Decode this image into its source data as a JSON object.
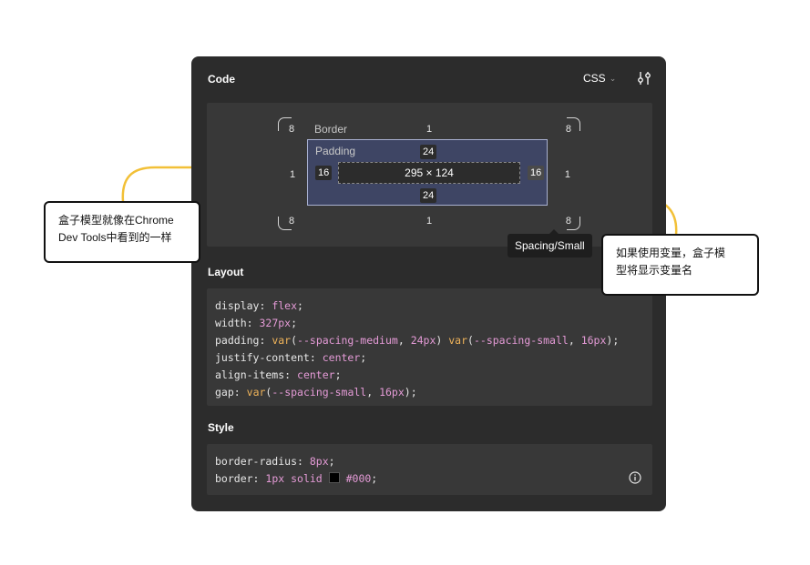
{
  "panel": {
    "title": "Code",
    "language": "CSS",
    "chevron": "⌄",
    "settings_icon": "sliders-icon"
  },
  "box_model": {
    "border_label": "Border",
    "border": {
      "top": "1",
      "bottom": "1",
      "left": "1",
      "right": "1"
    },
    "radius": {
      "tl": "8",
      "tr": "8",
      "bl": "8",
      "br": "8"
    },
    "padding_label": "Padding",
    "padding": {
      "top": "24",
      "bottom": "24",
      "left": "16",
      "right": "16"
    },
    "content_size": "295 × 124",
    "tooltip": "Spacing/Small"
  },
  "layout": {
    "title": "Layout",
    "lines": [
      [
        {
          "t": "display",
          "c": "p"
        },
        {
          "t": ": ",
          "c": "p"
        },
        {
          "t": "flex",
          "c": "v"
        },
        {
          "t": ";",
          "c": "p"
        }
      ],
      [
        {
          "t": "width",
          "c": "p"
        },
        {
          "t": ": ",
          "c": "p"
        },
        {
          "t": "327px",
          "c": "v"
        },
        {
          "t": ";",
          "c": "p"
        }
      ],
      [
        {
          "t": "padding",
          "c": "p"
        },
        {
          "t": ": ",
          "c": "p"
        },
        {
          "t": "var",
          "c": "o"
        },
        {
          "t": "(",
          "c": "p"
        },
        {
          "t": "--spacing-medium",
          "c": "v"
        },
        {
          "t": ", ",
          "c": "p"
        },
        {
          "t": "24px",
          "c": "v"
        },
        {
          "t": ") ",
          "c": "p"
        },
        {
          "t": "var",
          "c": "o"
        },
        {
          "t": "(",
          "c": "p"
        },
        {
          "t": "--spacing-small",
          "c": "v"
        },
        {
          "t": ", ",
          "c": "p"
        },
        {
          "t": "16px",
          "c": "v"
        },
        {
          "t": ");",
          "c": "p"
        }
      ],
      [
        {
          "t": "justify-content",
          "c": "p"
        },
        {
          "t": ": ",
          "c": "p"
        },
        {
          "t": "center",
          "c": "v"
        },
        {
          "t": ";",
          "c": "p"
        }
      ],
      [
        {
          "t": "align-items",
          "c": "p"
        },
        {
          "t": ": ",
          "c": "p"
        },
        {
          "t": "center",
          "c": "v"
        },
        {
          "t": ";",
          "c": "p"
        }
      ],
      [
        {
          "t": "gap",
          "c": "p"
        },
        {
          "t": ": ",
          "c": "p"
        },
        {
          "t": "var",
          "c": "o"
        },
        {
          "t": "(",
          "c": "p"
        },
        {
          "t": "--spacing-small",
          "c": "v"
        },
        {
          "t": ", ",
          "c": "p"
        },
        {
          "t": "16px",
          "c": "v"
        },
        {
          "t": ");",
          "c": "p"
        }
      ]
    ]
  },
  "style": {
    "title": "Style",
    "line1": [
      {
        "t": "border-radius",
        "c": "p"
      },
      {
        "t": ": ",
        "c": "p"
      },
      {
        "t": "8px",
        "c": "v"
      },
      {
        "t": ";",
        "c": "p"
      }
    ],
    "line2_prefix": [
      {
        "t": "border",
        "c": "p"
      },
      {
        "t": ": ",
        "c": "p"
      },
      {
        "t": "1px solid ",
        "c": "v"
      }
    ],
    "line2_color": "#000",
    "line2_suffix": ";",
    "swatch_color": "#000000",
    "info_icon": "info-icon"
  },
  "callouts": {
    "left_line1": "盒子模型就像在Chrome",
    "left_line2": "Dev Tools中看到的一样",
    "right_line1": "如果使用变量，盒子模",
    "right_line2": "型将显示变量名"
  },
  "colors": {
    "panel_bg": "#2c2c2c",
    "arrow": "#f2c037",
    "value_pink": "#e59bd7",
    "value_orange": "#f0b45a",
    "padding_fill": "#3e4564"
  }
}
